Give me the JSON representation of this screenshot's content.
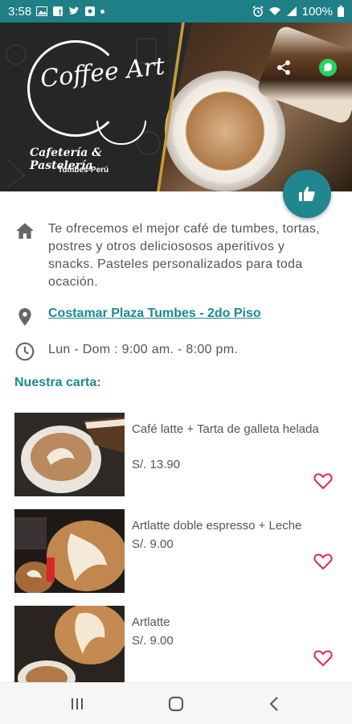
{
  "status_bar": {
    "time": "3:58",
    "battery": "100%",
    "left_icons": [
      "gallery-icon",
      "facebook-icon",
      "twitter-icon",
      "app-icon"
    ],
    "right_icons": [
      "alarm-icon",
      "wifi-icon",
      "signal-icon",
      "battery-icon"
    ]
  },
  "hero": {
    "logo_text": "Coffee Art",
    "logo_subtitle": "Cafetería & Pastelería",
    "logo_location": "Tumbes-Perú",
    "actions": [
      "share-icon",
      "whatsapp-icon"
    ],
    "fab_icon": "thumbs-up-icon"
  },
  "info": {
    "description": "Te ofrecemos el mejor café de tumbes, tortas, postres y otros deliciososos aperitivos y snacks. Pasteles personalizados para toda ocación.",
    "address": "Costamar Plaza Tumbes - 2do Piso",
    "hours": "Lun - Dom : 9:00 am. - 8:00 pm."
  },
  "menu": {
    "title": "Nuestra carta:",
    "items": [
      {
        "name": "Café latte + Tarta de galleta helada",
        "price": "S/. 13.90"
      },
      {
        "name": "Artlatte doble espresso + Leche",
        "price": "S/. 9.00"
      },
      {
        "name": "Artlatte",
        "price": "S/. 9.00"
      }
    ]
  },
  "nav": {
    "buttons": [
      "recent-apps-icon",
      "home-icon",
      "back-icon"
    ]
  },
  "colors": {
    "accent": "#1b8a91",
    "status_bar": "#1e7f86",
    "heart": "#e0284f"
  }
}
